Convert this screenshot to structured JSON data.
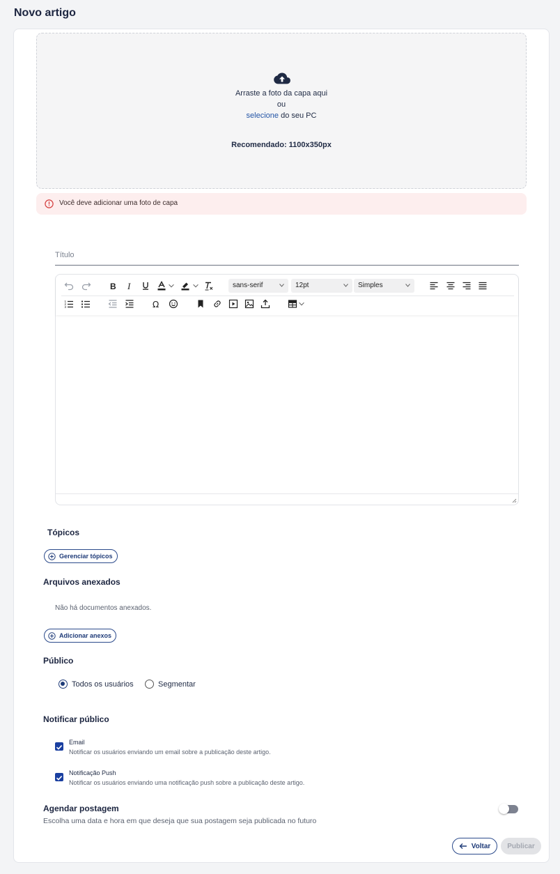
{
  "page": {
    "title": "Novo artigo"
  },
  "cover": {
    "drag_text": "Arraste a foto da capa aqui",
    "or_text": "ou",
    "select_link": "selecione",
    "select_suffix": "do seu PC",
    "recommended": "Recomendado: 1100x350px",
    "icon": "cloud-upload-icon"
  },
  "alert": {
    "text": "Você deve adicionar uma foto de capa",
    "color": "#fdeeee",
    "icon": "alert-circle-icon"
  },
  "title_field": {
    "placeholder": "Título",
    "value": ""
  },
  "editor": {
    "font_family": "sans-serif",
    "font_size": "12pt",
    "line_height": "Simples"
  },
  "topics": {
    "heading": "Tópicos",
    "manage_button": "Gerenciar tópicos"
  },
  "attachments": {
    "heading": "Arquivos anexados",
    "empty_text": "Não há documentos anexados.",
    "add_button": "Adicionar anexos"
  },
  "audience": {
    "heading": "Público",
    "options": [
      {
        "label": "Todos os usuários",
        "selected": true
      },
      {
        "label": "Segmentar",
        "selected": false
      }
    ]
  },
  "notify": {
    "heading": "Notificar público",
    "options": [
      {
        "title": "Email",
        "description": "Notificar os usuários enviando um email sobre a publicação deste artigo.",
        "checked": true
      },
      {
        "title": "Notificação Push",
        "description": "Notificar os usuários enviando uma notificação push sobre a publicação deste artigo.",
        "checked": true
      }
    ]
  },
  "schedule": {
    "heading": "Agendar postagem",
    "description": "Escolha uma data e hora em que deseja que sua postagem seja publicada no futuro",
    "enabled": false
  },
  "actions": {
    "back_label": "Voltar",
    "publish_label": "Publicar"
  },
  "colors": {
    "primary": "#1f3b78",
    "checkbox": "#1a3fa0",
    "link": "#2455a6"
  }
}
